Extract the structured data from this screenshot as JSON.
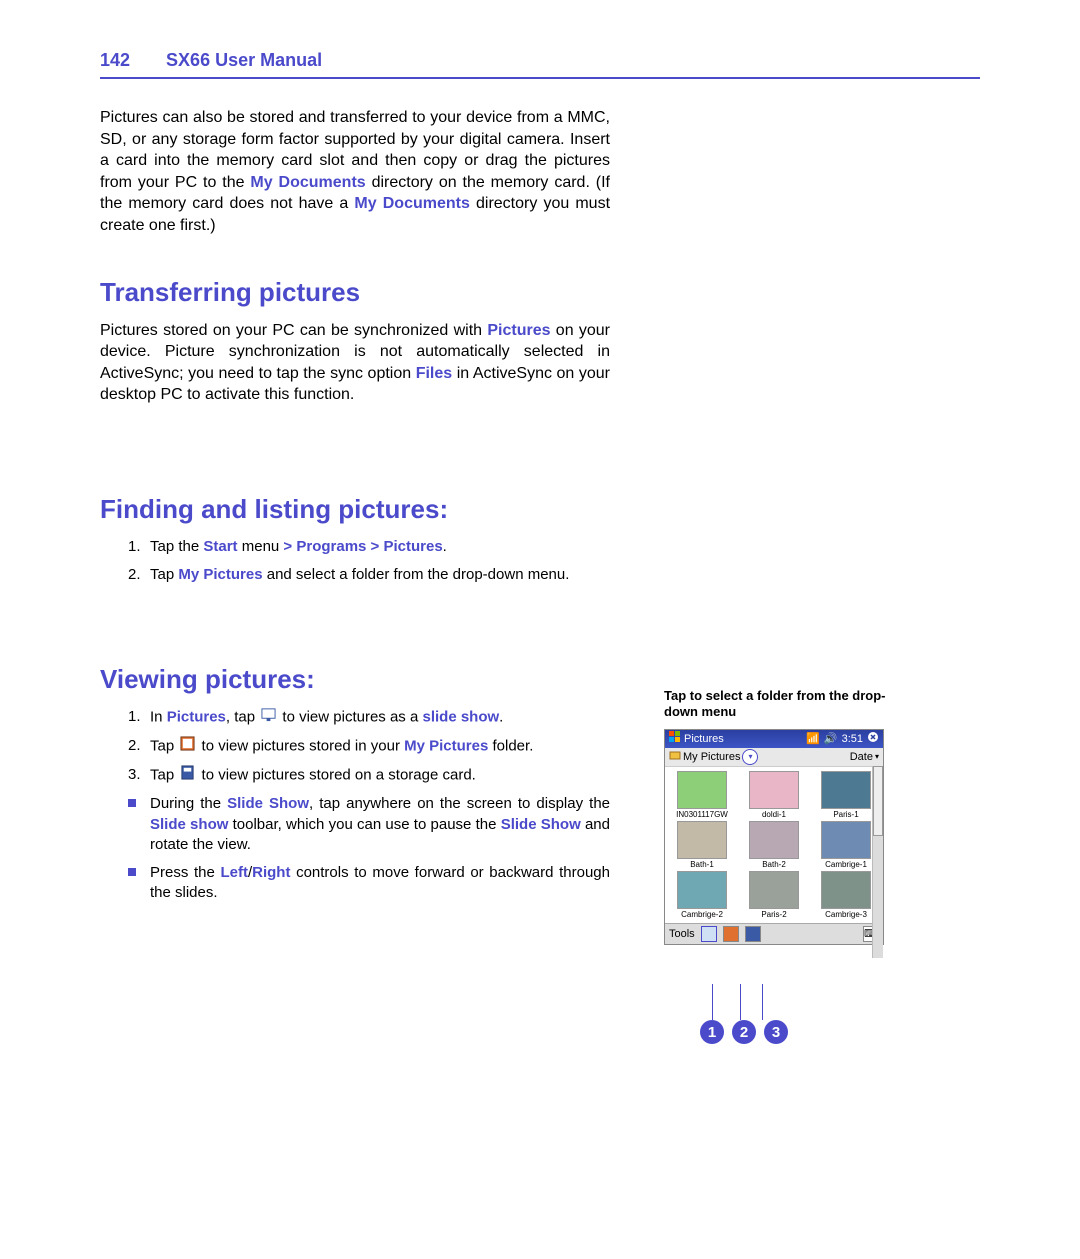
{
  "header": {
    "page_no": "142",
    "title": "SX66 User Manual"
  },
  "intro_para_parts": {
    "p1_a": "Pictures can also be stored and transferred to your device from a MMC, SD, or any storage form factor supported by your digital camera. Insert a card into the memory card slot and then copy or drag the pictures from your PC to the ",
    "p1_b": "My Documents",
    "p1_c": " directory on the memory card. (If the memory card does not have a ",
    "p1_d": "My Documents",
    "p1_e": " directory you must create one first.)"
  },
  "sections": {
    "transferring_title": "Transferring pictures",
    "transferring_parts": {
      "a": "Pictures stored on your PC can be synchronized with ",
      "b": "Pictures",
      "c": " on your device. Picture synchronization is not automatically selected in ActiveSync; you need to tap the sync option ",
      "d": "Files",
      "e": " in ActiveSync on your desktop PC to activate this function."
    },
    "finding_title": "Finding and listing pictures:",
    "finding_steps": {
      "s1a": "Tap the ",
      "s1b": "Start",
      "s1c": " menu ",
      "s1d": "> Programs > Pictures",
      "s1e": ".",
      "s2a": "Tap ",
      "s2b": "My Pictures",
      "s2c": " and select a folder from the drop-down menu."
    },
    "viewing_title": "Viewing pictures:",
    "viewing_steps": {
      "s1a": "In ",
      "s1b": "Pictures",
      "s1c": ", tap ",
      "s1d": " to view pictures as a ",
      "s1e": "slide show",
      "s1f": ".",
      "s2a": "Tap ",
      "s2b": " to view pictures stored in your ",
      "s2c": "My Pictures",
      "s2d": " folder.",
      "s3a": "Tap ",
      "s3b": " to view pictures stored on a storage card.",
      "b1a": "During the ",
      "b1b": "Slide Show",
      "b1c": ", tap anywhere on the screen to display the ",
      "b1d": "Slide show",
      "b1e": " toolbar, which you can use to pause the ",
      "b1f": "Slide Show",
      "b1g": " and rotate the view.",
      "b2a": "Press the ",
      "b2b": "Left",
      "b2c": "/",
      "b2d": "Right",
      "b2e": " controls to move forward or backward through the slides."
    }
  },
  "right_caption": "Tap to select a folder from the drop-down menu",
  "device": {
    "titlebar_app": "Pictures",
    "titlebar_time": "3:51",
    "folderbar_left": "My Pictures",
    "folderbar_right": "Date",
    "thumbs": [
      {
        "label": "IN0301117GW",
        "bg": "#8ccf78"
      },
      {
        "label": "doldi-1",
        "bg": "#e8b6c6"
      },
      {
        "label": "Paris-1",
        "bg": "#4d7a92"
      },
      {
        "label": "Bath-1",
        "bg": "#c2b9a6"
      },
      {
        "label": "Bath-2",
        "bg": "#b7a8b4"
      },
      {
        "label": "Cambrige-1",
        "bg": "#6d8bb3"
      },
      {
        "label": "Cambrige-2",
        "bg": "#6fa7b2"
      },
      {
        "label": "Paris-2",
        "bg": "#9aa09a"
      },
      {
        "label": "Cambrige-3",
        "bg": "#7f928a"
      }
    ],
    "bottombar_tools": "Tools"
  },
  "legend": {
    "n1": "1",
    "n2": "2",
    "n3": "3"
  }
}
